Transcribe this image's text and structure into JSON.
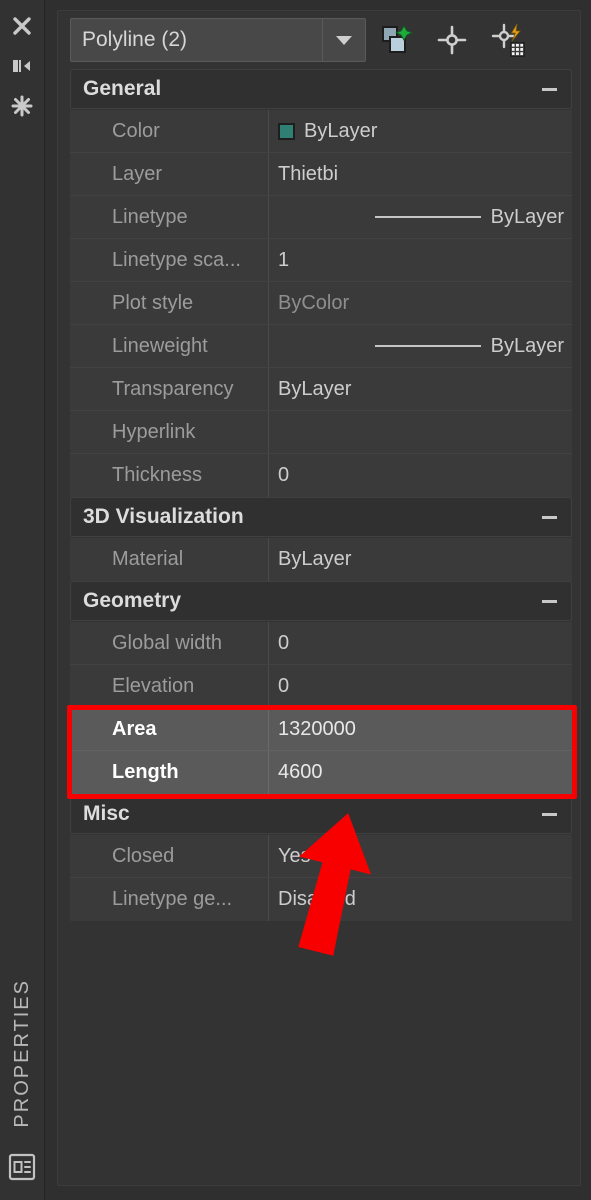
{
  "rail": {
    "top_buttons": [
      {
        "name": "close-icon",
        "label": "Close"
      },
      {
        "name": "auto-hide-icon",
        "label": "Auto-hide"
      },
      {
        "name": "panel-options-icon",
        "label": "Properties options"
      }
    ],
    "vertical_title": "PROPERTIES",
    "bottom_icon_label": "Properties"
  },
  "toolbar": {
    "object_selector_value": "Polyline (2)",
    "buttons": [
      {
        "name": "select-objects-icon",
        "label": "Select Objects"
      },
      {
        "name": "pick-point-icon",
        "label": "Pick Point"
      },
      {
        "name": "quick-select-icon",
        "label": "Quick Select"
      }
    ]
  },
  "colors": {
    "accent_red": "#f80000",
    "color_swatch": "#2f7f72",
    "panel_bg": "#333333",
    "row_bg": "#3a3a3a",
    "highlight_row_bg": "#5a5a5a"
  },
  "sections": [
    {
      "title": "General",
      "collapse_label": "−",
      "rows": [
        {
          "label": "Color",
          "value": "ByLayer",
          "kind": "swatch",
          "dim": false
        },
        {
          "label": "Layer",
          "value": "Thietbi",
          "kind": "text",
          "dim": false
        },
        {
          "label": "Linetype",
          "value": "ByLayer",
          "kind": "linetype",
          "dim": false
        },
        {
          "label": "Linetype sca...",
          "value": "1",
          "kind": "text",
          "dim": false
        },
        {
          "label": "Plot style",
          "value": "ByColor",
          "kind": "text",
          "dim": true
        },
        {
          "label": "Lineweight",
          "value": "ByLayer",
          "kind": "linetype",
          "dim": false
        },
        {
          "label": "Transparency",
          "value": "ByLayer",
          "kind": "text",
          "dim": false
        },
        {
          "label": "Hyperlink",
          "value": "",
          "kind": "text",
          "dim": false
        },
        {
          "label": "Thickness",
          "value": "0",
          "kind": "text",
          "dim": false
        }
      ]
    },
    {
      "title": "3D Visualization",
      "collapse_label": "−",
      "rows": [
        {
          "label": "Material",
          "value": "ByLayer",
          "kind": "text",
          "dim": false
        }
      ]
    },
    {
      "title": "Geometry",
      "collapse_label": "−",
      "rows": [
        {
          "label": "Global width",
          "value": "0",
          "kind": "text",
          "dim": false
        },
        {
          "label": "Elevation",
          "value": "0",
          "kind": "text",
          "dim": false
        },
        {
          "label": "Area",
          "value": "1320000",
          "kind": "text",
          "dim": false,
          "highlight": true
        },
        {
          "label": "Length",
          "value": "4600",
          "kind": "text",
          "dim": false,
          "highlight": true
        }
      ]
    },
    {
      "title": "Misc",
      "collapse_label": "−",
      "rows": [
        {
          "label": "Closed",
          "value": "Yes",
          "kind": "text",
          "dim": false
        },
        {
          "label": "Linetype ge...",
          "value": "Disabled",
          "kind": "text",
          "dim": false
        }
      ]
    }
  ]
}
